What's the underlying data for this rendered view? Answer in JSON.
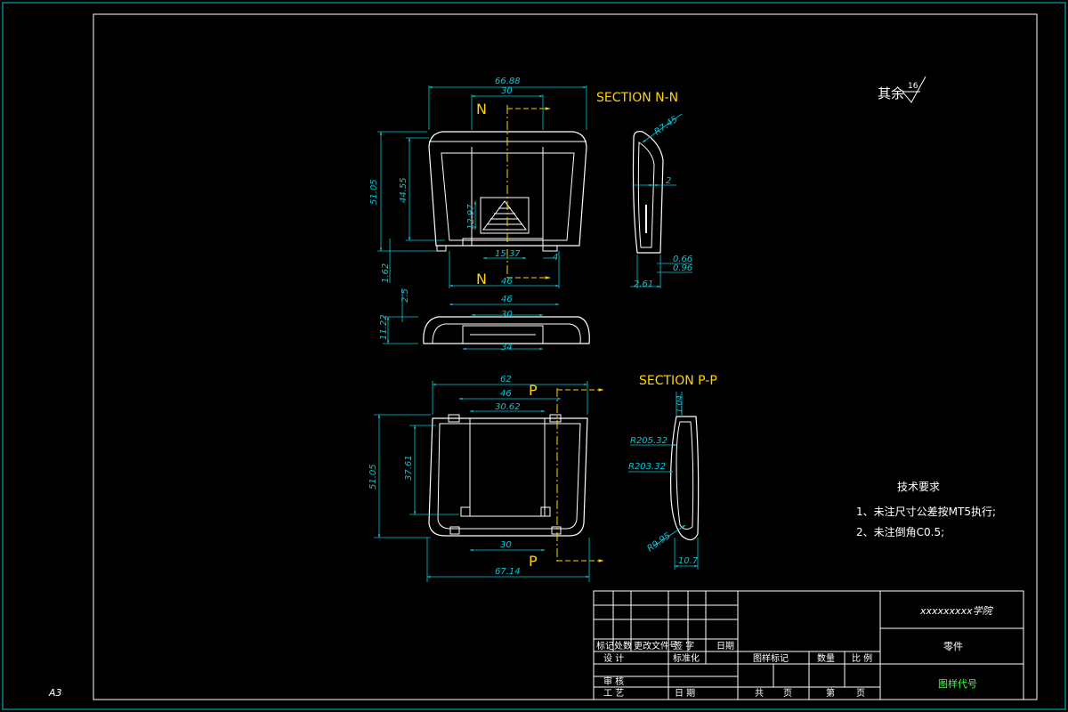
{
  "sheet": {
    "size_label": "A3"
  },
  "roughness": {
    "prefix": "其余",
    "value": "16"
  },
  "views": {
    "front": {
      "dims": {
        "overall_width": "66.88",
        "inner_width": "30",
        "overall_height": "51.05",
        "inner_height": "44.55",
        "bottom_offset": "1.62",
        "rib_height": "12.97",
        "rib_width": "15.37",
        "tab_width": "4",
        "base_width": "46"
      },
      "section_marker": "N"
    },
    "section_n": {
      "title": "SECTION N-N",
      "dims": {
        "radius": "R7.45",
        "wall": "2",
        "d1": "0.66",
        "d2": "0.96",
        "d3": "2.61"
      }
    },
    "bottom": {
      "dims": {
        "w_outer": "46",
        "w_inner": "30",
        "w_base": "34",
        "h_total": "11.22",
        "h_step": "2.5"
      }
    },
    "plan": {
      "dims": {
        "overall_width": "62",
        "mid_width": "46",
        "inner_width": "30.62",
        "overall_height": "51.05",
        "inner_height": "37.61",
        "bottom_width": "30",
        "base_width": "67.14"
      },
      "section_marker": "P"
    },
    "section_p": {
      "title": "SECTION P-P",
      "dims": {
        "top": "1.04",
        "r_outer": "R205.32",
        "r_inner": "R203.32",
        "r_corner": "R9.95",
        "width": "10.7"
      }
    }
  },
  "tech": {
    "title": "技术要求",
    "items": [
      "1、未注尺寸公差按MT5执行;",
      "2、未注倒角C0.5;"
    ]
  },
  "title_block": {
    "company": "xxxxxxxxx学院",
    "part_name": "零件",
    "drawing_no": "图样代号",
    "rev_headers": [
      "标记",
      "处数",
      "更改文件号",
      "签 字",
      "日期"
    ],
    "design": "设 计",
    "standard": "标准化",
    "review": "审 核",
    "process": "工 艺",
    "date": "日 期",
    "mark_label": "图样标记",
    "qty_label": "数量",
    "scale_label": "比 例",
    "total": "共",
    "pages": "页",
    "page": "第",
    "page2": "页"
  },
  "colors": {
    "frame": "#00c8d8",
    "outline": "#ffffff",
    "dim": "#00c8d8",
    "section": "#ffd400",
    "centerline": "#ffd400",
    "title_green": "#3cff3c"
  }
}
